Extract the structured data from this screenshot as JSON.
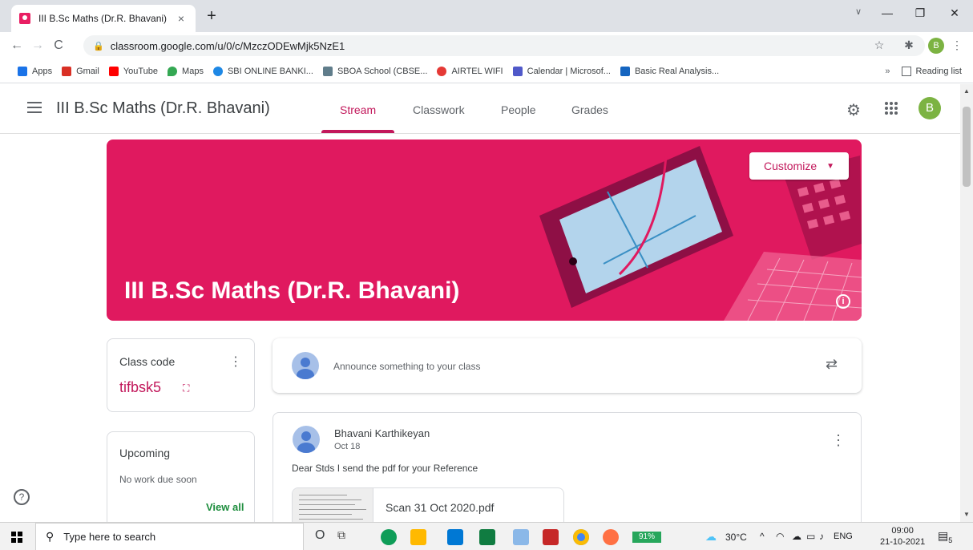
{
  "browser": {
    "tab_title": "III B.Sc Maths (Dr.R. Bhavani)",
    "tab_close": "×",
    "new_tab": "+",
    "url": "classroom.google.com/u/0/c/MzczODEwMjk5NzE1",
    "profile_initial": "B",
    "bookmarks": [
      {
        "label": "Apps",
        "icon": "apps-grid-icon",
        "color": "#1a73e8"
      },
      {
        "label": "Gmail",
        "icon": "gmail-icon",
        "color": "#d93025"
      },
      {
        "label": "YouTube",
        "icon": "youtube-icon",
        "color": "#ff0000"
      },
      {
        "label": "Maps",
        "icon": "maps-icon",
        "color": "#34a853"
      },
      {
        "label": "SBI ONLINE BANKI...",
        "icon": "sbi-icon",
        "color": "#1e88e5"
      },
      {
        "label": "SBOA School (CBSE...",
        "icon": "school-icon",
        "color": "#607d8b"
      },
      {
        "label": "AIRTEL WIFI",
        "icon": "airtel-icon",
        "color": "#e53935"
      },
      {
        "label": "Calendar | Microsof...",
        "icon": "teams-icon",
        "color": "#5059c9"
      },
      {
        "label": "Basic Real Analysis...",
        "icon": "s-icon",
        "color": "#1565c0"
      }
    ],
    "more_bookmarks": "»",
    "reading_list": "Reading list"
  },
  "classroom": {
    "class_title": "III B.Sc Maths (Dr.R. Bhavani)",
    "tabs": [
      "Stream",
      "Classwork",
      "People",
      "Grades"
    ],
    "active_tab": "Stream",
    "user_initial": "B",
    "banner": {
      "title": "III B.Sc Maths (Dr.R. Bhavani)",
      "customize_label": "Customize",
      "color": "#e0195f"
    },
    "class_code": {
      "label": "Class code",
      "value": "tifbsk5"
    },
    "upcoming": {
      "label": "Upcoming",
      "empty_text": "No work due soon",
      "view_all": "View all"
    },
    "announce_placeholder": "Announce something to your class",
    "post": {
      "author": "Bhavani Karthikeyan",
      "date": "Oct 18",
      "body": "Dear Stds I send the pdf for your Reference",
      "attachment_name": "Scan 31 Oct 2020.pdf"
    },
    "accent": "#c2185b"
  },
  "taskbar": {
    "search_placeholder": "Type here to search",
    "battery": "91%",
    "weather": "30°C",
    "language": "ENG",
    "time": "09:00",
    "date": "21-10-2021",
    "notifications": "5"
  }
}
